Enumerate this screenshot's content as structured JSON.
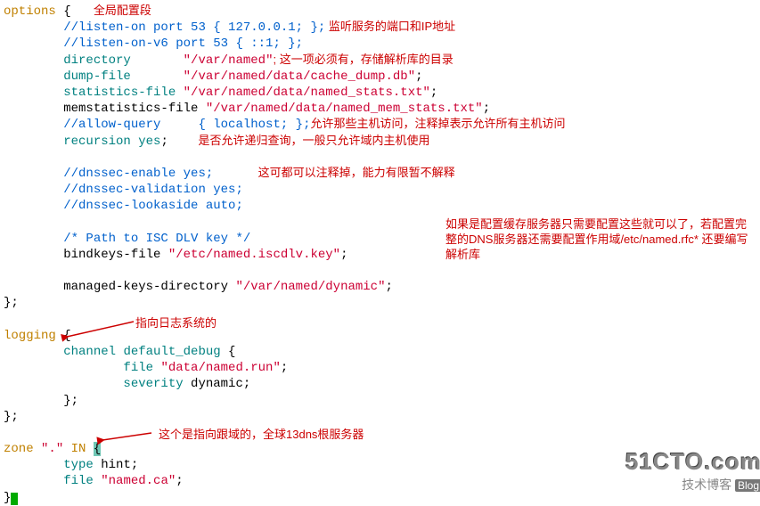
{
  "kw": {
    "options": "options",
    "logging": "logging",
    "zone": "zone",
    "directory": "directory",
    "dumpfile": "dump-file",
    "statsfile": "statistics-file",
    "recursion": "recursion",
    "yes": "yes",
    "channel": "channel",
    "default_debug": "default_debug",
    "file": "file",
    "severity": "severity",
    "dynamic": "dynamic",
    "type": "type",
    "hint": "hint",
    "in": "IN"
  },
  "str": {
    "varnamed": "\"/var/named\"",
    "cachedump": "\"/var/named/data/cache_dump.db\"",
    "namedstats": "\"/var/named/data/named_stats.txt\"",
    "memstats": "\"/var/named/data/named_mem_stats.txt\"",
    "iscdlv": "\"/etc/named.iscdlv.key\"",
    "dynamic": "\"/var/named/dynamic\"",
    "datanamedrun": "\"data/named.run\"",
    "namedca": "\"named.ca\"",
    "dot": "\".\""
  },
  "txt": {
    "memstatsfile": "memstatistics-file ",
    "bindkeysfile": "bindkeys-file ",
    "mkd": "managed-keys-directory "
  },
  "cmt": {
    "listenon": "//listen-on port 53 { 127.0.0.1; };",
    "listenonv6": "//listen-on-v6 port 53 { ::1; };",
    "allowquery": "//allow-query     { localhost; };",
    "dnssecenable": "//dnssec-enable yes;",
    "dnssecvalidation": "//dnssec-validation yes;",
    "dnsseclookaside": "//dnssec-lookaside auto;",
    "pathcomment": "/* Path to ISC DLV key */"
  },
  "ann": {
    "globalseg": "全局配置段",
    "listen": " 监听服务的端口和IP地址",
    "diropt": "; 这一项必须有，存储解析库的目录",
    "allowq": "允许那些主机访问，注释掉表示允许所有主机访问",
    "recursion": "是否允许递归查询，一般只允许域内主机使用",
    "dnssec": "这可都可以注释掉，能力有限暂不解释",
    "logging": "指向日志系统的",
    "zone": "这个是指向跟域的，全球13dns根服务器",
    "sidenote": "如果是配置缓存服务器只需要配置这些就可以了，若配置完整的DNS服务器还需要配置作用域/etc/named.rfc*  还要编写解析库"
  },
  "watermark": {
    "big": "51CTO.com",
    "small": "技术博客",
    "blog": "Blog"
  }
}
